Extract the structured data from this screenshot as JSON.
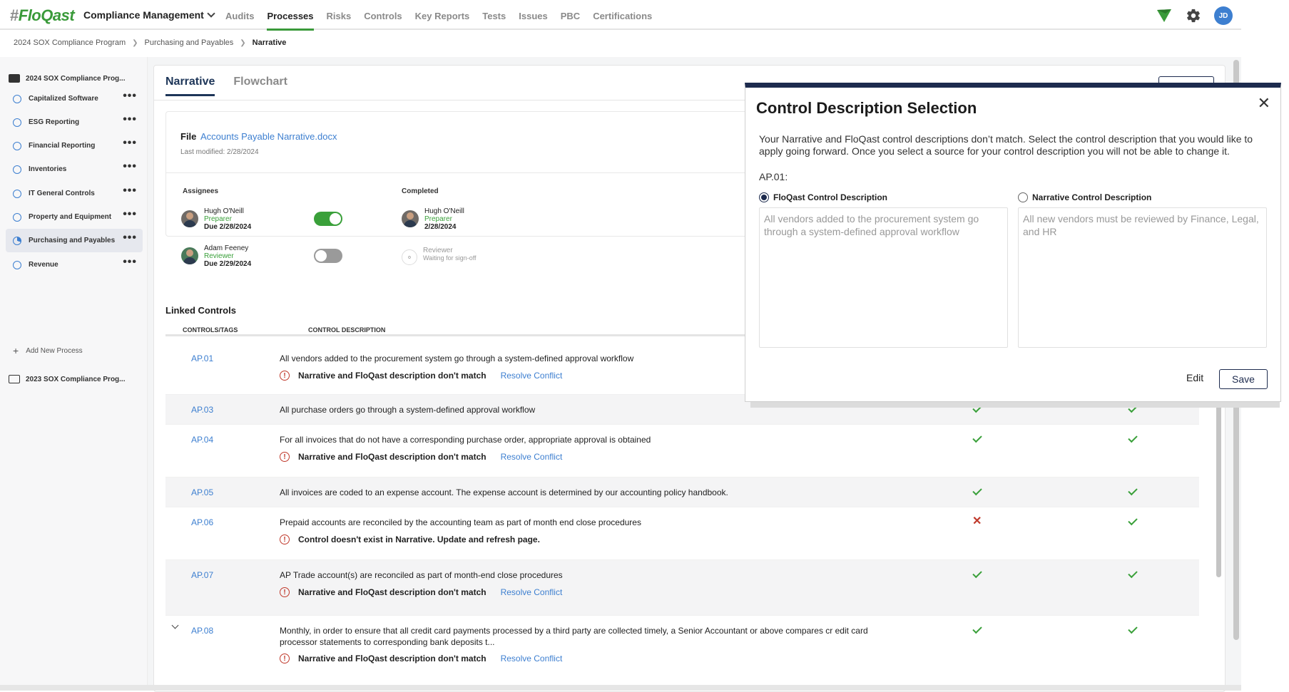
{
  "app": {
    "logo_hash": "#",
    "logo_text": "FloQast",
    "module": "Compliance Management"
  },
  "nav": [
    "Audits",
    "Processes",
    "Risks",
    "Controls",
    "Key Reports",
    "Tests",
    "Issues",
    "PBC",
    "Certifications"
  ],
  "nav_active": "Processes",
  "user": {
    "initials": "JD"
  },
  "breadcrumb": {
    "level1": "2024 SOX Compliance Program",
    "level2": "Purchasing and Payables",
    "current": "Narrative"
  },
  "sidebar": {
    "folder_current": "2024 SOX Compliance Prog...",
    "items": [
      {
        "label": "Capitalized Software"
      },
      {
        "label": "ESG Reporting"
      },
      {
        "label": "Financial Reporting"
      },
      {
        "label": "Inventories"
      },
      {
        "label": "IT General Controls"
      },
      {
        "label": "Property and Equipment"
      },
      {
        "label": "Purchasing and Payables"
      },
      {
        "label": "Revenue"
      }
    ],
    "add_label": "Add New Process",
    "folder_prev": "2023 SOX Compliance Prog..."
  },
  "tabs": [
    "Narrative",
    "Flowchart"
  ],
  "file": {
    "label": "File",
    "name": "Accounts Payable Narrative.docx",
    "modified": "Last modified: 2/28/2024"
  },
  "assignees": {
    "header": "Assignees",
    "people": [
      {
        "name": "Hugh O'Neill",
        "role": "Preparer",
        "due": "Due 2/28/2024",
        "toggle": "on"
      },
      {
        "name": "Adam Feeney",
        "role": "Reviewer",
        "due": "Due 2/29/2024",
        "toggle": "off"
      }
    ]
  },
  "completed": {
    "header": "Completed",
    "preparer": {
      "name": "Hugh O'Neill",
      "role": "Preparer",
      "date": "2/28/2024"
    },
    "reviewer": {
      "role": "Reviewer",
      "status": "Waiting for sign-off"
    }
  },
  "linked_controls": {
    "header": "Linked Controls",
    "col_controls": "CONTROLS/TAGS",
    "col_desc": "CONTROL DESCRIPTION",
    "resolve_label": "Resolve Conflict",
    "rows": [
      {
        "id": "AP.01",
        "desc": "All vendors added to the procurement system go through a system-defined approval workflow",
        "warning": "Narrative and FloQast description don't match",
        "resolve": true,
        "c1": "",
        "c2": ""
      },
      {
        "id": "AP.03",
        "desc": "All purchase orders go through a system-defined approval workflow",
        "warning": "",
        "resolve": false,
        "c1": "check",
        "c2": "check"
      },
      {
        "id": "AP.04",
        "desc": "For all invoices that do not have a corresponding purchase order, appropriate approval is obtained",
        "warning": "Narrative and FloQast description don't match",
        "resolve": true,
        "c1": "check",
        "c2": "check"
      },
      {
        "id": "AP.05",
        "desc": "All invoices are coded to an expense account. The expense account is determined by our accounting policy handbook.",
        "warning": "",
        "resolve": false,
        "c1": "check",
        "c2": "check"
      },
      {
        "id": "AP.06",
        "desc": "Prepaid accounts are reconciled by the accounting team as part of month end close procedures",
        "warning": "Control doesn't exist in Narrative. Update and refresh page.",
        "resolve": false,
        "c1": "x",
        "c2": "check"
      },
      {
        "id": "AP.07",
        "desc": "AP Trade account(s) are reconciled as part of month-end close procedures",
        "warning": "Narrative and FloQast description don't match",
        "resolve": true,
        "c1": "check",
        "c2": "check"
      },
      {
        "id": "AP.08",
        "desc": "Monthly, in order to ensure that all credit card payments processed by a third party are collected timely, a Senior Accountant or above compares cr edit card processor statements to corresponding bank deposits t...",
        "warning": "Narrative and FloQast description don't match",
        "resolve": true,
        "c1": "check",
        "c2": "check"
      }
    ]
  },
  "modal": {
    "title": "Control Description Selection",
    "close": "✕",
    "body": "Your Narrative and FloQast control descriptions don’t match. Select the control description that you would like to apply going forward. Once you select a source for your control description you will not be able to change it.",
    "control_id": "AP.01:",
    "option_floqast": "FloQast Control Description",
    "option_narrative": "Narrative Control Description",
    "floqast_text": "All vendors added to the procurement system go through a system-defined approval workflow",
    "narrative_text": "All new vendors must be reviewed by Finance, Legal, and HR",
    "selected": "floqast",
    "edit_label": "Edit",
    "save_label": "Save"
  },
  "colors": {
    "brand_green": "#3a9a3a",
    "navy": "#1d2b4e",
    "link_blue": "#3d7fd0",
    "error_red": "#c0392b"
  }
}
